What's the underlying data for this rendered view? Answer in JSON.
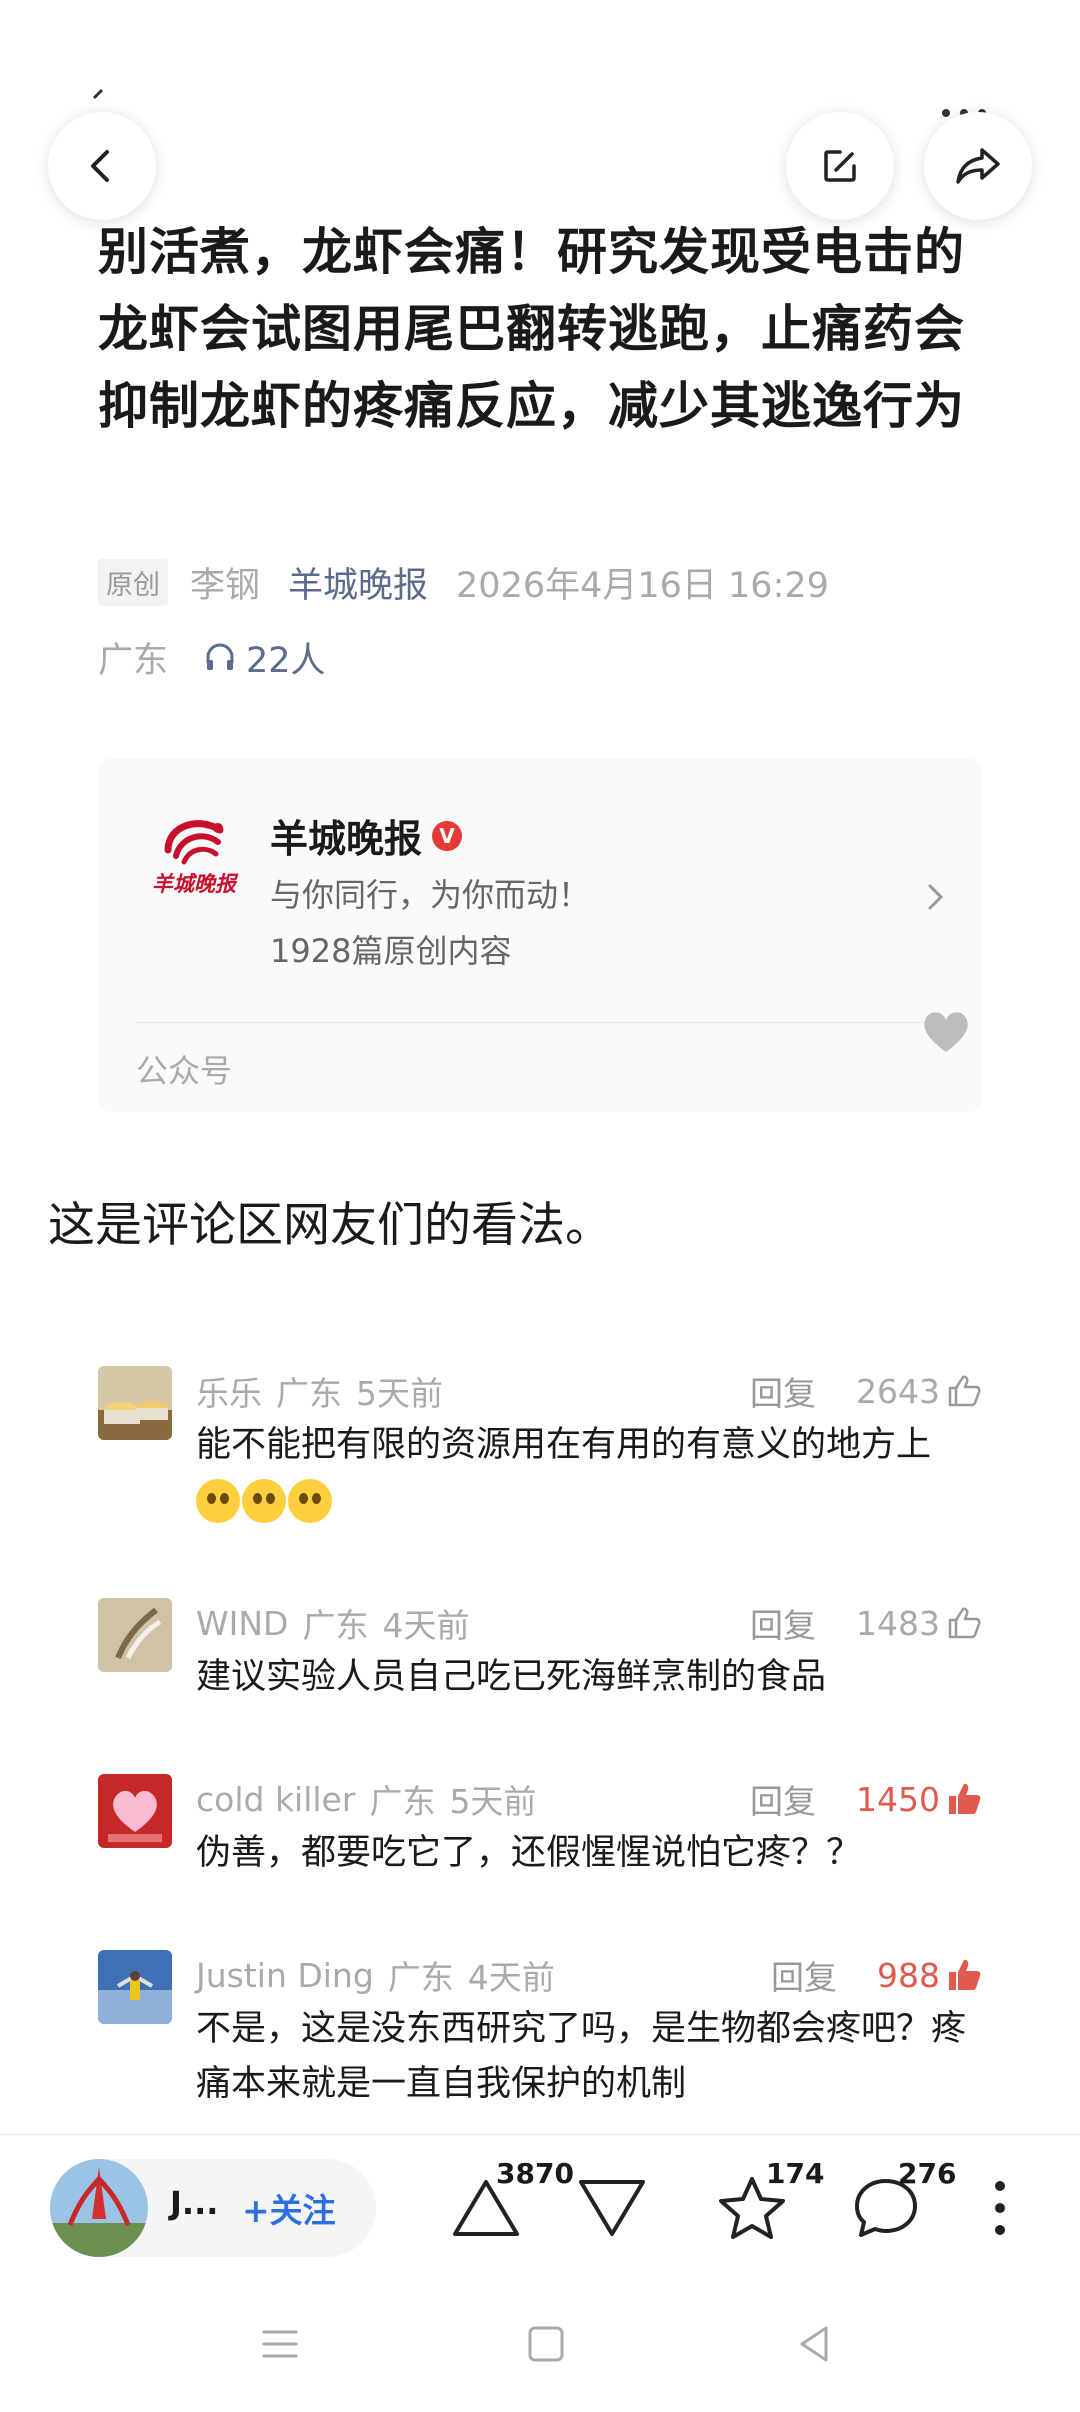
{
  "header": {
    "back_icon": "back-arrow-icon",
    "edit_icon": "edit-icon",
    "share_icon": "share-icon"
  },
  "article": {
    "title": "别活煮，龙虾会痛！研究发现受电击的龙虾会试图用尾巴翻转逃跑，止痛药会抑制龙虾的疼痛反应，减少其逃逸行为",
    "original_tag": "原创",
    "author": "李钢",
    "source": "羊城晚报",
    "datetime": "2026年4月16日 16:29",
    "location": "广东",
    "listeners": "22人"
  },
  "account_card": {
    "name": "羊城晚报",
    "verified": "V",
    "slogan": "与你同行，为你而动！",
    "count": "1928篇原创内容",
    "type": "公众号",
    "logo_text": "羊城晚报"
  },
  "intro": "这是评论区网友们的看法。",
  "comments": [
    {
      "user": "乐乐",
      "location": "广东",
      "time": "5天前",
      "reply": "回复",
      "likes": "2643",
      "text": "能不能把有限的资源用在有用的有意义的地方上"
    },
    {
      "user": "WIND",
      "location": "广东",
      "time": "4天前",
      "reply": "回复",
      "likes": "1483",
      "text": "建议实验人员自己吃已死海鲜烹制的食品"
    },
    {
      "user": "cold killer",
      "location": "广东",
      "time": "5天前",
      "reply": "回复",
      "likes": "1450",
      "text": "伪善，都要吃它了，还假惺惺说怕它疼？？"
    },
    {
      "user": "Justin Ding",
      "location": "广东",
      "time": "4天前",
      "reply": "回复",
      "likes": "988",
      "text": "不是，这是没东西研究了吗，是生物都会疼吧？疼痛本来就是一直自我保护的机制"
    }
  ],
  "bottom_bar": {
    "user_short": "J...",
    "follow_label": "+关注",
    "upvote_count": "3870",
    "favorite_count": "174",
    "comment_count": "276"
  },
  "colors": {
    "accent_blue": "#2e6fe0",
    "link_gray_blue": "#5b6b8c",
    "hot_red": "#e05a4e"
  }
}
